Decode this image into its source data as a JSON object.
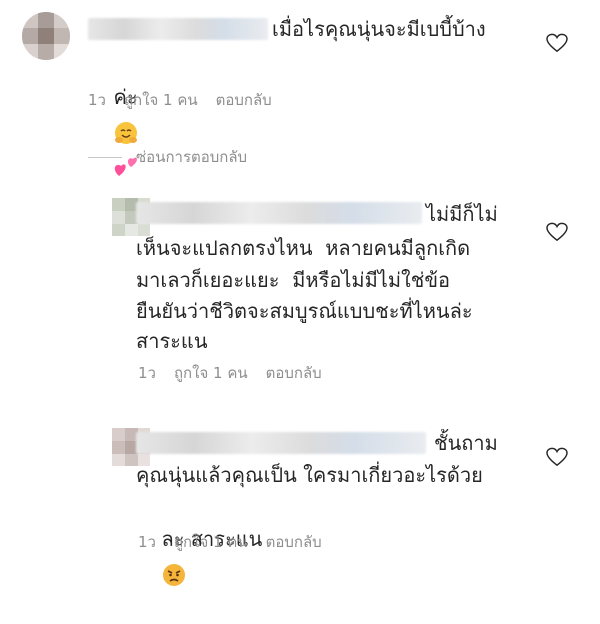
{
  "comments": [
    {
      "text_line1": "เมื่อไรคุณนุ่นจะมีเบบี้บ้าง",
      "text_line2": "ค่ะ",
      "time": "1ว",
      "likes": "ถูกใจ 1 คน",
      "reply": "ตอบกลับ"
    },
    {
      "text_lines": [
        "ไม่มีก็ไม่",
        "เห็นจะแปลกตรงไหน  หลายคนมีลูกเกิด",
        "มาเลวก็เยอะแยะ  มีหรือไม่มีไม่ใช่ข้อ",
        "ยืนยันว่าชีวิตจะสมบูรณ์แบบชะที่ไหนล่ะ",
        "สาระแน"
      ],
      "time": "1ว",
      "likes": "ถูกใจ 1 คน",
      "reply": "ตอบกลับ"
    },
    {
      "text_lines": [
        "ชั้นถาม",
        "คุณนุ่นแล้วคุณเป็น ใครมาเกี่ยวอะไรด้วย",
        "ละ สาระแน"
      ],
      "time": "1ว",
      "likes": "ถูกใจ 1 คน",
      "reply": "ตอบกลับ"
    }
  ],
  "hide_replies": "ซ่อนการตอบกลับ",
  "colors": {
    "text": "#262626",
    "meta": "#8e8e8e",
    "heart_stroke": "#262626"
  },
  "icons": [
    "heart-icon",
    "hugging-face-emoji",
    "two-hearts-emoji",
    "angry-face-emoji"
  ]
}
